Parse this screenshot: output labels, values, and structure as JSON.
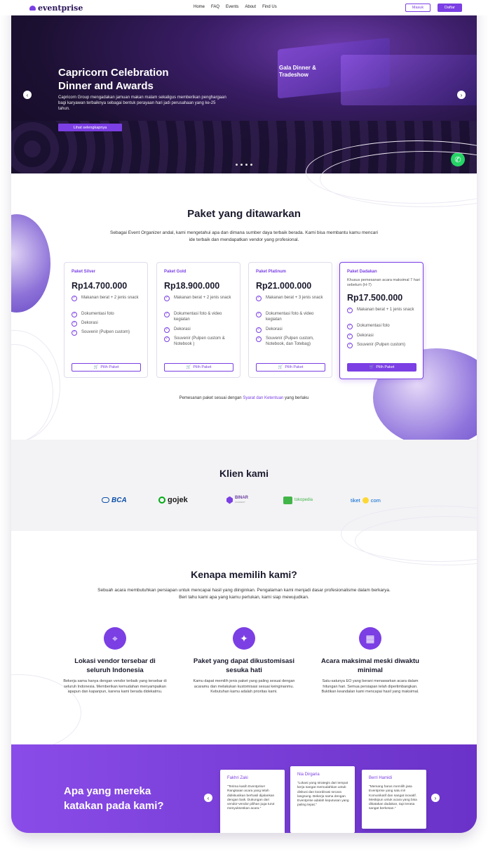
{
  "brand": {
    "name": "eventprise",
    "accent": "#7b3fe4"
  },
  "nav": {
    "items": [
      "Home",
      "FAQ",
      "Events",
      "About",
      "Find Us"
    ],
    "login": "Masuk",
    "register": "Daftar"
  },
  "hero": {
    "title": "Capricorn Celebration Dinner and Awards",
    "description": "Capricorn Group mengadakan jamuan makan malam sekaligus memberikan penghargaan bagi karyawan terbaiknya sebagai bentuk perayaan hari jadi perusahaan yang ke-25 tahun.",
    "cta": "Lihat selengkapnya",
    "sign": "Gala Dinner & Tradeshow",
    "slides": 4
  },
  "packages": {
    "title": "Paket yang ditawarkan",
    "subtitle": "Sebagai Event Organizer andal, kami mengetahui apa dan dimana sumber daya terbaik berada. Kami bisa membantu kamu mencari ide terbaik dan mendapatkan vendor yang profesional.",
    "cards": [
      {
        "name": "Paket Silver",
        "price": "Rp14.700.000",
        "features": [
          "Makanan berat + 2 jenis snack",
          "Dokumentasi foto",
          "Dekorasi",
          "Souvenir (Pulpen custom)"
        ],
        "button": "Pilih Paket"
      },
      {
        "name": "Paket Gold",
        "price": "Rp18.900.000",
        "features": [
          "Makanan berat + 2 jenis snack",
          "Dokumentasi foto & video kegiatan",
          "Dekorasi",
          "Souvenir (Pulpen custom & Notebook )"
        ],
        "button": "Pilih Paket"
      },
      {
        "name": "Paket Platinum",
        "price": "Rp21.000.000",
        "features": [
          "Makanan berat + 3 jenis snack",
          "Dokumentasi foto & video kegiatan",
          "Dekorasi",
          "Souvenir (Pulpen custom, Notebook, dan Totebag)"
        ],
        "button": "Pilih Paket"
      },
      {
        "name": "Paket Dadakan",
        "note": "Khusus pemesanan acara maksimal 7 hari sebelum (H-7)",
        "price": "Rp17.500.000",
        "features": [
          "Makanan berat + 1 jenis snack",
          "Dokumentasi foto",
          "Dekorasi",
          "Souvenir (Pulpen custom)"
        ],
        "button": "Pilih Paket"
      }
    ],
    "footer_prefix": "Pemesanan paket sesuai dengan",
    "footer_link": "Syarat dan Ketentuan",
    "footer_suffix": "yang berlaku"
  },
  "clients": {
    "title": "Klien kami",
    "logos": [
      "BCA",
      "gojek",
      "BINAR",
      "tokopedia",
      "tiket",
      "com"
    ],
    "binar_sub": "ACADEMY"
  },
  "why": {
    "title": "Kenapa memilih kami?",
    "subtitle": "Sebuah acara membutuhkan persiapan untuk mencapai hasil yang diinginkan. Pengalaman kami menjadi dasar profesionalisme dalam berkarya. Beri tahu kami apa yang kamu perlukan, kami siap mewujudkan.",
    "features": [
      {
        "title": "Lokasi vendor tersebar di seluruh Indonesia",
        "desc": "Bekerja sama hanya dengan vendor terbaik yang tersebar di seluruh Indonesia. Memberikan kemudahan menyampaikan apapun dan kapanpun, karena kami berada didekatmu."
      },
      {
        "title": "Paket yang dapat dikustomisasi sesuka hati",
        "desc": "Kamu dapat memilih jenis paket yang paling sesuai dengan acaramu dan melakukan kustomisasi sesuai keinginanmu. Kebutuhan kamu adalah prioritas kami."
      },
      {
        "title": "Acara maksimal meski diwaktu minimal",
        "desc": "Satu-satunya EO yang berani menawarkan acara dalam hitungan hari. Semua persiapan telah dipertimbangkan. Buktikan keandalan kami mencapai hasil yang maksimal."
      }
    ]
  },
  "testimonials": {
    "title": "Apa yang mereka katakan pada kami?",
    "items": [
      {
        "name": "Fakhri Zaki",
        "text": "\"Terima kasih Eventprise! Rangkaian acara yang telah didiskusikan berhasil dijalankan dengan baik. Dukungan dari vendor-vendor pilihan juga turut menyukseskan acara.\""
      },
      {
        "name": "Nia Dirgaria",
        "text": "\"Lokasi yang strategis dari tempat kerja sangat memudahkan untuk diskusi dan koordinasi secara langsung. Bekerja sama dengan Eventprise adalah keputusan yang paling tepat.\""
      },
      {
        "name": "Berri Hamidi",
        "text": "\"Memang harus memilih jasa Eventprise yang satu ini! Komunikatif dan sangat inovatif. Meskipun untuk acara yang bisa dikatakan dadakan, tapi terasa sangat berkesan.\""
      }
    ]
  }
}
